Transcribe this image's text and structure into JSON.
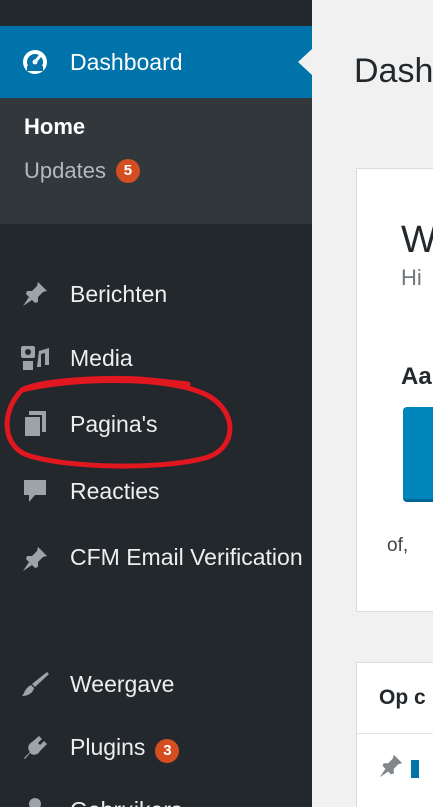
{
  "sidebar": {
    "dashboard_label": "Dashboard",
    "submenu": {
      "home_label": "Home",
      "updates_label": "Updates",
      "updates_count": "5"
    },
    "items": [
      {
        "label": "Berichten",
        "icon": "pushpin-icon"
      },
      {
        "label": "Media",
        "icon": "media-icon"
      },
      {
        "label": "Pagina's",
        "icon": "pages-icon"
      },
      {
        "label": "Reacties",
        "icon": "comment-icon"
      },
      {
        "label": "CFM Email Verification",
        "icon": "pushpin-icon"
      },
      {
        "label": "Weergave",
        "icon": "paintbrush-icon"
      },
      {
        "label": "Plugins",
        "icon": "plugin-icon",
        "count": "3"
      },
      {
        "label": "Gebruikers",
        "icon": "users-icon"
      }
    ]
  },
  "main": {
    "page_title": "Dashboard",
    "welcome": {
      "heading": "W",
      "subtext": "Hi"
    },
    "get_started_heading": "Aa",
    "or_text": "of,",
    "activity_heading": "Op c"
  },
  "colors": {
    "sidebar_bg": "#23282d",
    "submenu_bg": "#32373c",
    "active_blue": "#0073aa",
    "badge": "#d54e21",
    "button_blue": "#0085ba",
    "annotation_red": "#e0171f"
  }
}
